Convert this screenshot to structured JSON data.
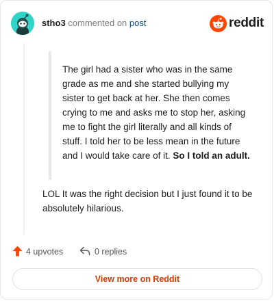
{
  "header": {
    "username": "stho3",
    "verb": "commented on",
    "link_text": "post",
    "brand": "reddit"
  },
  "comment": {
    "quote_before_bold": "The girl had a sister who was in the same grade as me and she started bullying my sister to get back at her. She then comes crying to me and asks me to stop her, asking me to fight the girl literally and all kinds of stuff. I told her to be less mean in the future and I would take care of it. ",
    "quote_bold": "So I told an adult.",
    "reply": "LOL It was the right decision but I just found it to be absolutely hilarious."
  },
  "actions": {
    "upvotes_label": "4 upvotes",
    "replies_label": "0 replies"
  },
  "footer": {
    "view_more_label": "View more on Reddit"
  },
  "colors": {
    "brand_orange": "#ff4500",
    "avatar_teal": "#30d5c8",
    "link_blue": "#0a4d8c",
    "view_more_text": "#d93a00"
  },
  "icons": {
    "avatar": "snoo-avatar-icon",
    "logo": "reddit-logo-icon",
    "upvote": "upvote-arrow-icon",
    "reply": "reply-arrow-icon"
  }
}
